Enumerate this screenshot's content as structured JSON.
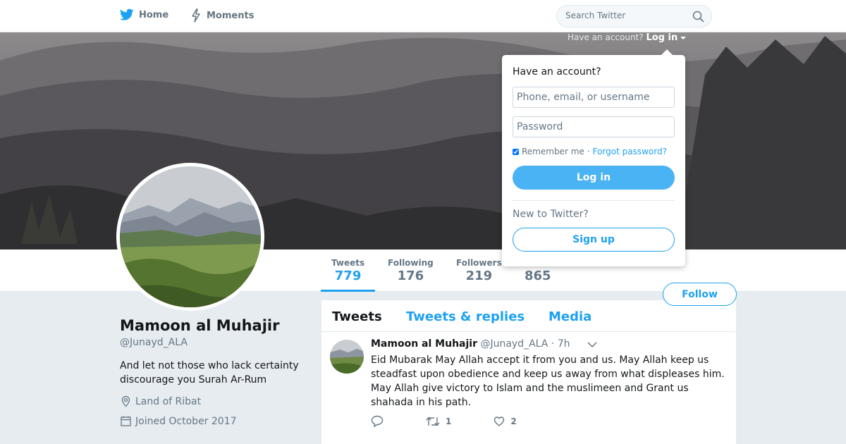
{
  "nav": {
    "home_label": "Home",
    "moments_label": "Moments",
    "search_placeholder": "Search Twitter",
    "accent_color": "#1da1f2"
  },
  "login_hint": {
    "text": "Have an account?",
    "link": "Log in"
  },
  "login_dropdown": {
    "title": "Have an account?",
    "username_placeholder": "Phone, email, or username",
    "password_placeholder": "Password",
    "remember_label": "Remember me",
    "separator": "·",
    "forgot_label": "Forgot password?",
    "login_button": "Log in",
    "new_label": "New to Twitter?",
    "signup_button": "Sign up"
  },
  "stats": {
    "tweets": {
      "label": "Tweets",
      "value": "779"
    },
    "following": {
      "label": "Following",
      "value": "176"
    },
    "followers": {
      "label": "Followers",
      "value": "219"
    },
    "likes": {
      "value": "865"
    }
  },
  "follow_button": "Follow",
  "profile": {
    "name": "Mamoon al Muhajir",
    "handle": "@Junayd_ALA",
    "bio": "And let not those who lack certainty discourage you Surah Ar-Rum",
    "location": "Land of Ribat",
    "joined": "Joined October 2017"
  },
  "timeline": {
    "tabs": [
      "Tweets",
      "Tweets & replies",
      "Media"
    ],
    "tweet": {
      "name": "Mamoon al Muhajir",
      "handle": "@Junayd_ALA",
      "time": "· 7h",
      "text": "Eid Mubarak May Allah accept it from you and us. May Allah keep us steadfast upon obedience and keep us away from what displeases him. May Allah give victory to Islam and the muslimeen and Grant us shahada in his path.",
      "retweets": "1",
      "likes": "2"
    }
  }
}
